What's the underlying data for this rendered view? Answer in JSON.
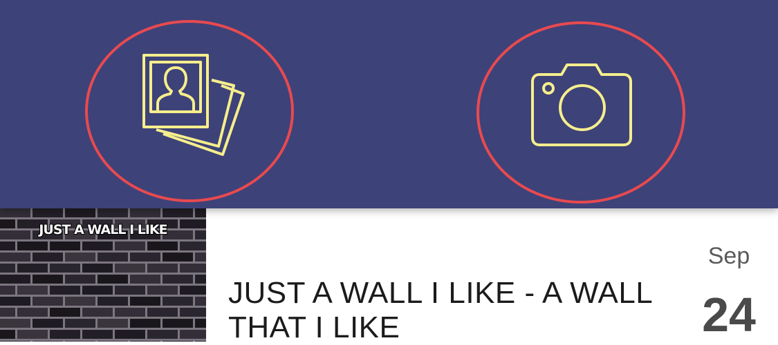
{
  "toolbar": {
    "background_color": "#3d4279",
    "icon_color": "#f6ee8c",
    "highlight_color": "#e84a4f",
    "buttons": [
      {
        "icon": "photo-gallery-icon"
      },
      {
        "icon": "camera-icon"
      }
    ]
  },
  "post": {
    "thumbnail_caption": "JUST A WALL I LIKE",
    "title": "JUST A WALL I LIKE - A WALL THAT I LIKE",
    "date": {
      "month": "Sep",
      "day": "24"
    }
  }
}
